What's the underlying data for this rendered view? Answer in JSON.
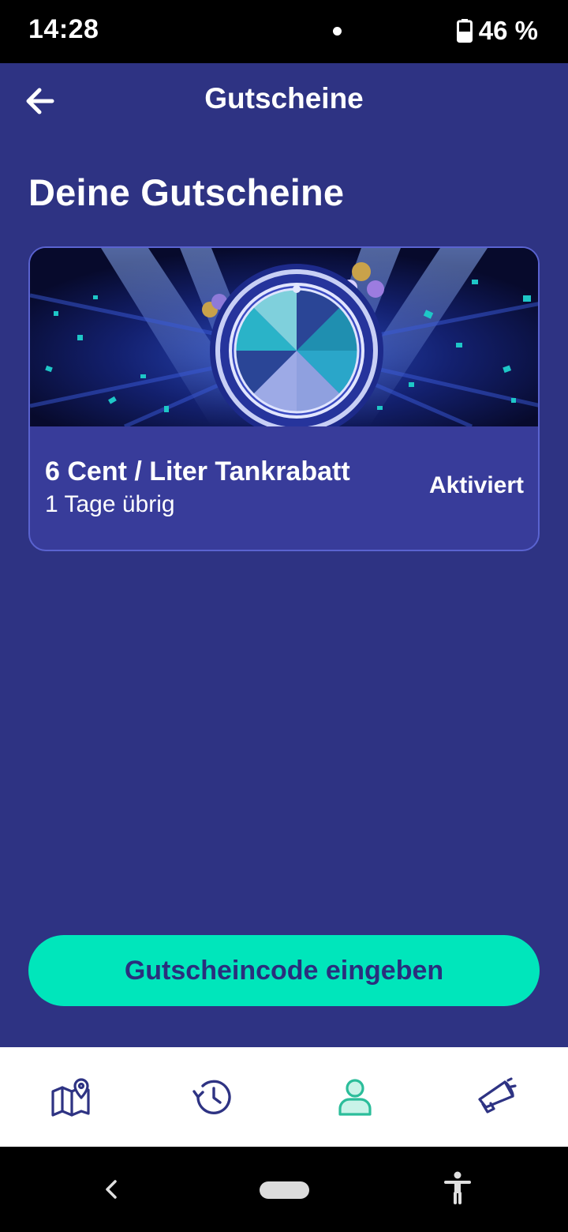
{
  "status_bar": {
    "time": "14:28",
    "battery": "46 %"
  },
  "header": {
    "title": "Gutscheine",
    "back_icon": "arrow-left-icon"
  },
  "page": {
    "heading": "Deine Gutscheine"
  },
  "vouchers": [
    {
      "title": "6 Cent / Liter Tankrabatt",
      "remaining": "1 Tage übrig",
      "status": "Aktiviert",
      "banner": "prize-wheel-image"
    }
  ],
  "actions": {
    "enter_code_label": "Gutscheincode eingeben"
  },
  "tab_bar": {
    "items": [
      {
        "icon": "map-pin-icon",
        "active": false
      },
      {
        "icon": "history-icon",
        "active": false
      },
      {
        "icon": "profile-icon",
        "active": true
      },
      {
        "icon": "megaphone-icon",
        "active": false
      }
    ]
  },
  "colors": {
    "background": "#2e3383",
    "card": "#383c9a",
    "accent": "#00e6bb",
    "tab_active": "#2bbd9a",
    "tab_inactive": "#2e3383"
  }
}
